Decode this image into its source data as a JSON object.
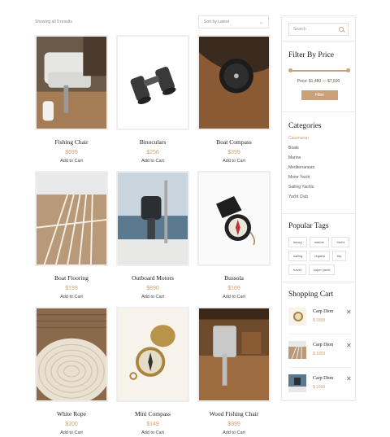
{
  "toolbar": {
    "results_text": "Showing all 9 results",
    "sort_value": "Sort by Latest",
    "sort_icon": "chevron-down-icon"
  },
  "products": [
    {
      "name": "Fishing Chair",
      "price": "$699",
      "cart_label": "Add to Cart",
      "image": "fishing-chair"
    },
    {
      "name": "Binoculars",
      "price": "$256",
      "cart_label": "Add to Cart",
      "image": "binoculars"
    },
    {
      "name": "Boat Compass",
      "price": "$399",
      "cart_label": "Add to Cart",
      "image": "boat-compass"
    },
    {
      "name": "Boat Flooring",
      "price": "$199",
      "cart_label": "Add to Cart",
      "image": "boat-flooring"
    },
    {
      "name": "Outboard Motors",
      "price": "$890",
      "cart_label": "Add to Cart",
      "image": "outboard-motor"
    },
    {
      "name": "Bussola",
      "price": "$169",
      "cart_label": "Add to Cart",
      "image": "bussola"
    },
    {
      "name": "White Rope",
      "price": "$200",
      "cart_label": "Add to Cart",
      "image": "white-rope"
    },
    {
      "name": "Mini Compass",
      "price": "$149",
      "cart_label": "Add to Cart",
      "image": "mini-compass"
    },
    {
      "name": "Wood Fishing Chair",
      "price": "$999",
      "cart_label": "Add to Cart",
      "image": "wood-fishing-chair"
    }
  ],
  "sidebar": {
    "search": {
      "placeholder": "Search",
      "icon": "search-icon"
    },
    "filter": {
      "title": "Filter By Price",
      "range_text": "Price: $1,480 — $7,500",
      "button_label": "Filter",
      "accent": "#c9a27a"
    },
    "categories": {
      "title": "Categories",
      "items": [
        "Catamaran",
        "Boats",
        "Marine",
        "Mediterranean",
        "Motor Yacht",
        "Sailing Yachts",
        "Yacht Club"
      ],
      "active_index": 0
    },
    "tags": {
      "title": "Popular Tags",
      "items": [
        "luxury",
        "marine",
        "Yacht",
        "sailing",
        "regatta",
        "trip",
        "travel",
        "super yacht"
      ]
    },
    "cart": {
      "title": "Shopping Cart",
      "items": [
        {
          "name": "Carp Dion",
          "price": "$ 1899",
          "image": "mini-compass"
        },
        {
          "name": "Carp Dion",
          "price": "$ 1899",
          "image": "boat-flooring"
        },
        {
          "name": "Carp Dion",
          "price": "$ 1899",
          "image": "outboard-motor"
        }
      ],
      "remove_icon": "close-icon"
    }
  }
}
